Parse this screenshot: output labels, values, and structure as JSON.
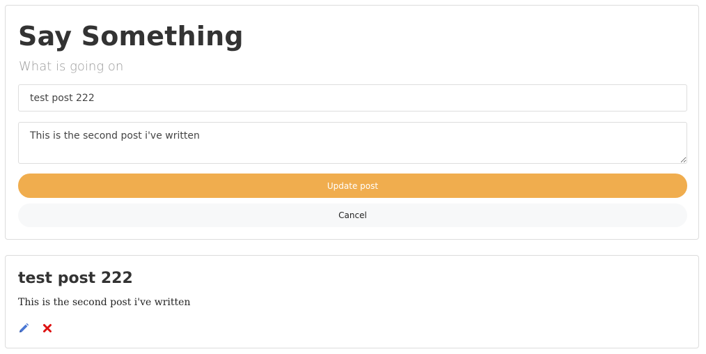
{
  "composer": {
    "title": "Say Something",
    "subtitle": "What is going on",
    "title_input_value": "test post 222",
    "body_input_value": "This is the second post i've written",
    "update_label": "Update post",
    "cancel_label": "Cancel"
  },
  "posts": [
    {
      "title": "test post 222",
      "body": "This is the second post i've written",
      "actions": [
        {
          "icon": "pencil-icon",
          "color": "#4a77d4"
        },
        {
          "icon": "x-mark-icon",
          "color": "#dd1111"
        }
      ]
    }
  ],
  "colors": {
    "accent": "#f0ad4e",
    "edit": "#4a77d4",
    "delete": "#dd1111"
  }
}
